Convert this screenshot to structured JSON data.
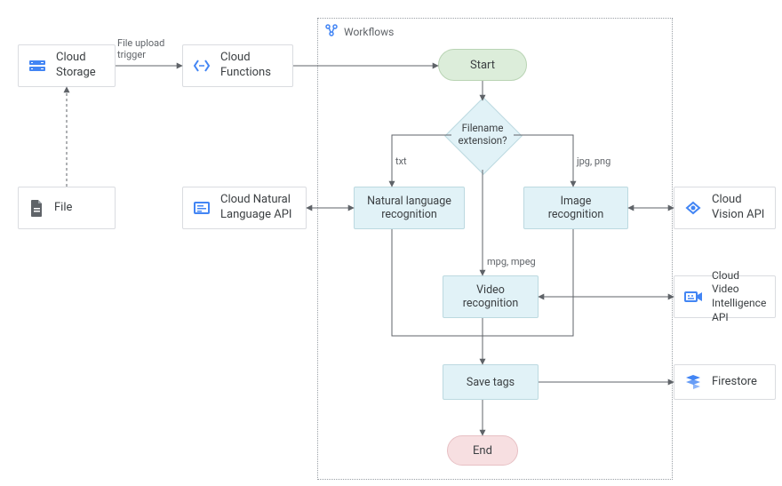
{
  "workflows_label": "Workflows",
  "nodes": {
    "cloud_storage": "Cloud\nStorage",
    "cloud_functions": "Cloud\nFunctions",
    "file": "File",
    "cloud_nl_api": "Cloud Natural\nLanguage API",
    "cloud_vision_api": "Cloud\nVision API",
    "cloud_video_api": "Cloud Video\nIntelligence API",
    "firestore": "Firestore",
    "start": "Start",
    "end": "End",
    "filename_ext": "Filename\nextension?",
    "nl_rec": "Natural language\nrecognition",
    "img_rec": "Image\nrecognition",
    "video_rec": "Video\nrecognition",
    "save_tags": "Save tags"
  },
  "edges": {
    "file_upload_trigger": "File upload\ntrigger",
    "txt": "txt",
    "jpg_png": "jpg, png",
    "mpg_mpeg": "mpg, mpeg"
  },
  "flow": [
    {
      "from": "file",
      "to": "cloud_storage",
      "style": "dotted"
    },
    {
      "from": "cloud_storage",
      "to": "cloud_functions",
      "label": "file_upload_trigger"
    },
    {
      "from": "cloud_functions",
      "to": "start"
    },
    {
      "from": "start",
      "to": "filename_ext"
    },
    {
      "from": "filename_ext",
      "to": "nl_rec",
      "label": "txt"
    },
    {
      "from": "filename_ext",
      "to": "img_rec",
      "label": "jpg_png"
    },
    {
      "from": "filename_ext",
      "to": "video_rec",
      "label": "mpg_mpeg"
    },
    {
      "from": "nl_rec",
      "to": "cloud_nl_api",
      "bidir": true
    },
    {
      "from": "img_rec",
      "to": "cloud_vision_api",
      "bidir": true
    },
    {
      "from": "video_rec",
      "to": "cloud_video_api",
      "bidir": true
    },
    {
      "from": "nl_rec",
      "to": "save_tags_merge"
    },
    {
      "from": "img_rec",
      "to": "save_tags_merge"
    },
    {
      "from": "video_rec",
      "to": "save_tags"
    },
    {
      "from": "save_tags",
      "to": "firestore"
    },
    {
      "from": "save_tags",
      "to": "end"
    }
  ],
  "colors": {
    "gcp_blue": "#4285f4",
    "workflow_fill": "#e1f2f7",
    "start_fill": "#dcedda",
    "end_fill": "#f7dfe1",
    "line": "#5f6368"
  }
}
